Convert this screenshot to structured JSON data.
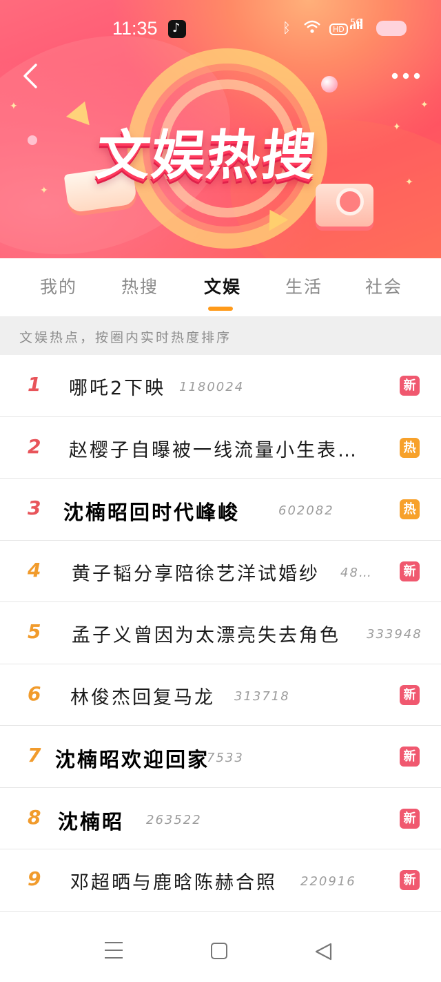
{
  "status_bar": {
    "time": "11:35",
    "icons": [
      "tiktok-icon",
      "bluetooth-icon",
      "wifi-icon",
      "hd-icon",
      "signal-5g-icon",
      "battery-icon"
    ],
    "signal_label": "5G"
  },
  "banner": {
    "title": "文娱热搜",
    "back_icon": "chevron-left-icon",
    "more_icon": "more-dots-icon"
  },
  "tabs": [
    {
      "label": "我的",
      "active": false
    },
    {
      "label": "热搜",
      "active": false
    },
    {
      "label": "文娱",
      "active": true
    },
    {
      "label": "生活",
      "active": false
    },
    {
      "label": "社会",
      "active": false
    }
  ],
  "info_strip": {
    "text": "文娱热点，按圈内实时热度排序"
  },
  "items": [
    {
      "rank": "1",
      "title": "哪吒2下映",
      "heat": "1180024",
      "badge": "新",
      "badge_type": "new",
      "rank_color": "#e8545a",
      "bold": false
    },
    {
      "rank": "2",
      "title": "赵樱子自曝被一线流量小生表…",
      "heat": "",
      "badge": "热",
      "badge_type": "hot",
      "rank_color": "#e8545a",
      "bold": false
    },
    {
      "rank": "3",
      "title": "沈楠昭回时代峰峻",
      "heat": "602082",
      "badge": "热",
      "badge_type": "hot",
      "rank_color": "#e8545a",
      "bold": true
    },
    {
      "rank": "4",
      "title": "黄子韬分享陪徐艺洋试婚纱",
      "heat": "48…",
      "badge": "新",
      "badge_type": "new",
      "rank_color": "#f19b2c",
      "bold": false
    },
    {
      "rank": "5",
      "title": "孟子义曾因为太漂亮失去角色",
      "heat": "333948",
      "badge": "",
      "badge_type": "",
      "rank_color": "#f19b2c",
      "bold": false
    },
    {
      "rank": "6",
      "title": "林俊杰回复马龙",
      "heat": "313718",
      "badge": "新",
      "badge_type": "new",
      "rank_color": "#f19b2c",
      "bold": false
    },
    {
      "rank": "7",
      "title": "沈楠昭欢迎回家",
      "heat": "7533",
      "badge": "新",
      "badge_type": "new",
      "rank_color": "#f19b2c",
      "bold": true
    },
    {
      "rank": "8",
      "title": "沈楠昭",
      "heat": "263522",
      "badge": "新",
      "badge_type": "new",
      "rank_color": "#f19b2c",
      "bold": true
    },
    {
      "rank": "9",
      "title": "邓超晒与鹿晗陈赫合照",
      "heat": "220916",
      "badge": "新",
      "badge_type": "new",
      "rank_color": "#f19b2c",
      "bold": false
    }
  ],
  "colors": {
    "badge_new": "#f0586f",
    "badge_hot": "#f7a12b",
    "tab_accent": "#ff9a1a"
  },
  "nav_bar": {
    "icons": [
      "menu-icon",
      "home-square-icon",
      "back-triangle-icon"
    ]
  }
}
